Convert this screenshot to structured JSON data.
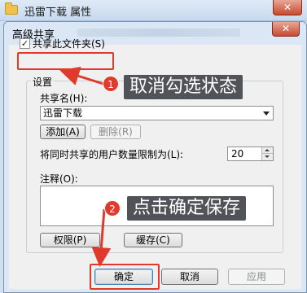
{
  "outer_window": {
    "title": "迅雷下载 属性",
    "close_glyph": "✕"
  },
  "dialog": {
    "title": "高级共享",
    "close_glyph": "✕",
    "share_checkbox": {
      "label": "共享此文件夹(S)",
      "checked": true,
      "check_glyph": "✓"
    },
    "settings_group": {
      "legend": "设置",
      "share_name_label": "共享名(H):",
      "share_name_value": "迅雷下载",
      "add_button": "添加(A)",
      "remove_button": "删除(R)",
      "user_limit_label": "将同时共享的用户数量限制为(L):",
      "user_limit_value": "20",
      "comment_label": "注释(O):",
      "comment_value": "",
      "permissions_button": "权限(P)",
      "caching_button": "缓存(C)"
    },
    "footer": {
      "ok_button": "确定",
      "cancel_button": "取消",
      "apply_button": "应用"
    }
  },
  "annotations": [
    {
      "number": "1",
      "text": "取消勾选状态"
    },
    {
      "number": "2",
      "text": "点击确定保存"
    }
  ],
  "colors": {
    "annotation_red": "#e03a2c",
    "callout_bg": "#505357",
    "dialog_bg": "#f0f0f0"
  }
}
